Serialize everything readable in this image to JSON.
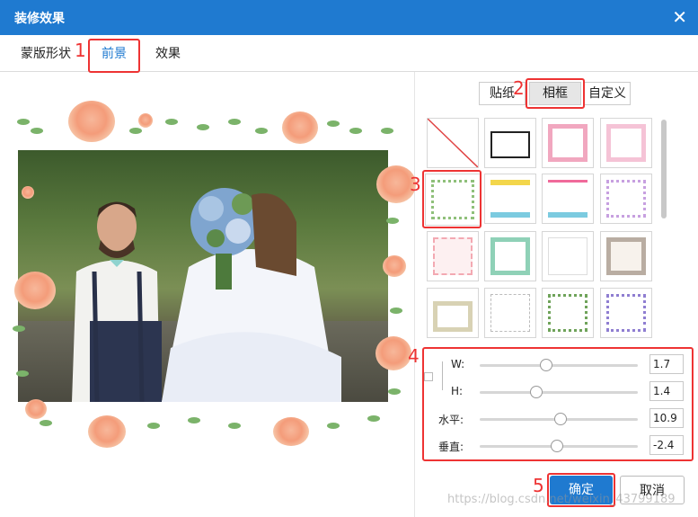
{
  "window": {
    "title": "装修效果",
    "close_icon": "close-icon"
  },
  "tabs": [
    {
      "label": "蒙版形状"
    },
    {
      "label": "前景",
      "active": true
    },
    {
      "label": "效果"
    }
  ],
  "annotations": [
    "1",
    "2",
    "3",
    "4",
    "5"
  ],
  "subtabs": [
    {
      "label": "贴纸"
    },
    {
      "label": "相框",
      "active": true
    },
    {
      "label": "自定义"
    }
  ],
  "frames": {
    "selected_index": 4,
    "items": [
      "none",
      "tv-frame",
      "pink-polaroid",
      "pink-love-frame",
      "floral-frame",
      "sun-frame",
      "heart-frame",
      "cartoon-frame",
      "pink-dotted-frame",
      "green-ticket-frame",
      "star-frame",
      "vintage-frame",
      "hanging-frame",
      "sketch-frame",
      "vine-frame",
      "violet-frame"
    ]
  },
  "controls": {
    "width": {
      "label": "W:",
      "value": "1.7",
      "level": 0.42
    },
    "height": {
      "label": "H:",
      "value": "1.4",
      "level": 0.36
    },
    "horizontal": {
      "label": "水平:",
      "value": "10.9",
      "level": 0.51
    },
    "vertical": {
      "label": "垂直:",
      "value": "-2.4",
      "level": 0.49
    }
  },
  "buttons": {
    "ok": "确定",
    "cancel": "取消"
  },
  "watermark": "https://blog.csdn.net/weixin_43799189",
  "colors": {
    "title_bar": "#1f7ad0",
    "annotation": "#ee3333",
    "primary": "#1f7ad0"
  }
}
